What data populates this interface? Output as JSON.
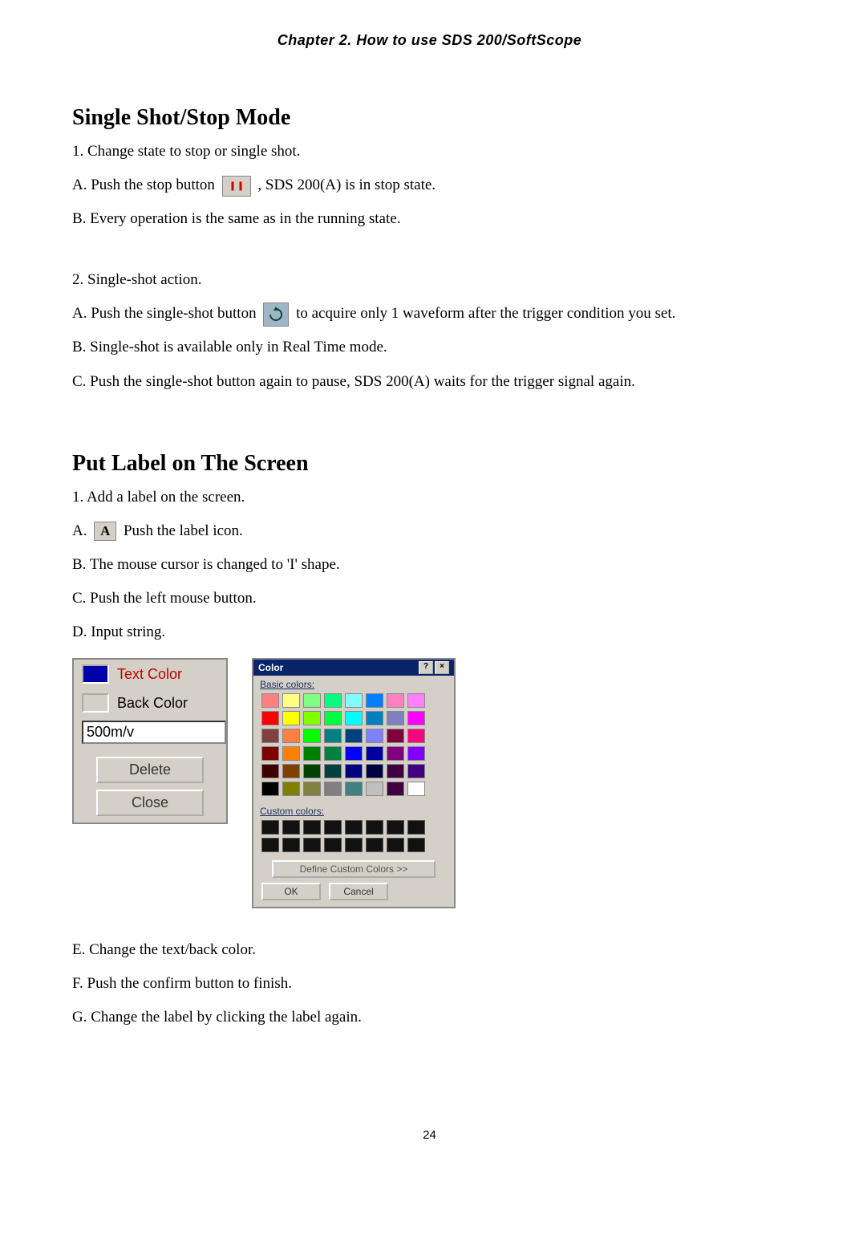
{
  "header": "Chapter 2. How to use SDS 200/SoftScope",
  "sec1": {
    "title": "Single Shot/Stop Mode",
    "l1": "1. Change state to stop or single shot.",
    "lA_pre": "A. Push the stop button ",
    "lA_post": ", SDS 200(A) is in stop state.",
    "lB": "B. Every operation is the same as in the running state.",
    "l2": "2. Single-shot action.",
    "l2A_pre": "A. Push the single-shot button ",
    "l2A_post": " to acquire only 1 waveform after the trigger condition you set.",
    "l2B": "B. Single-shot is available only in Real Time mode.",
    "l2C": "C. Push the single-shot button again to pause, SDS 200(A) waits for the trigger signal again."
  },
  "sec2": {
    "title": "Put Label on The Screen",
    "l1": "1. Add a label on the screen.",
    "lA_pre": "A. ",
    "lA_post": " Push the label icon.",
    "lB": "B. The mouse cursor is changed to 'I' shape.",
    "lC": "C. Push the left mouse button.",
    "lD": "D. Input string.",
    "lE": "E. Change the text/back color.",
    "lF": "F. Push the confirm button to finish.",
    "lG": "G. Change the label by clicking the label again."
  },
  "labelPanel": {
    "textColor": "Text Color",
    "backColor": "Back Color",
    "inputValue": "500m/v",
    "delete": "Delete",
    "close": "Close"
  },
  "colorDialog": {
    "title": "Color",
    "basic": "Basic colors:",
    "custom": "Custom colors:",
    "define": "Define Custom Colors >>",
    "ok": "OK",
    "cancel": "Cancel",
    "basicColors": [
      "#ff8080",
      "#ffff80",
      "#80ff80",
      "#00ff80",
      "#80ffff",
      "#0080ff",
      "#ff80c0",
      "#ff80ff",
      "#ff0000",
      "#ffff00",
      "#80ff00",
      "#00ff40",
      "#00ffff",
      "#0080c0",
      "#8080c0",
      "#ff00ff",
      "#804040",
      "#ff8040",
      "#00ff00",
      "#008080",
      "#004080",
      "#8080ff",
      "#800040",
      "#ff0080",
      "#800000",
      "#ff8000",
      "#008000",
      "#008040",
      "#0000ff",
      "#0000a0",
      "#800080",
      "#8000ff",
      "#400000",
      "#804000",
      "#004000",
      "#004040",
      "#000080",
      "#000040",
      "#400040",
      "#400080",
      "#000000",
      "#808000",
      "#808040",
      "#808080",
      "#408080",
      "#c0c0c0",
      "#400040",
      "#ffffff"
    ]
  },
  "pageNumber": "24"
}
